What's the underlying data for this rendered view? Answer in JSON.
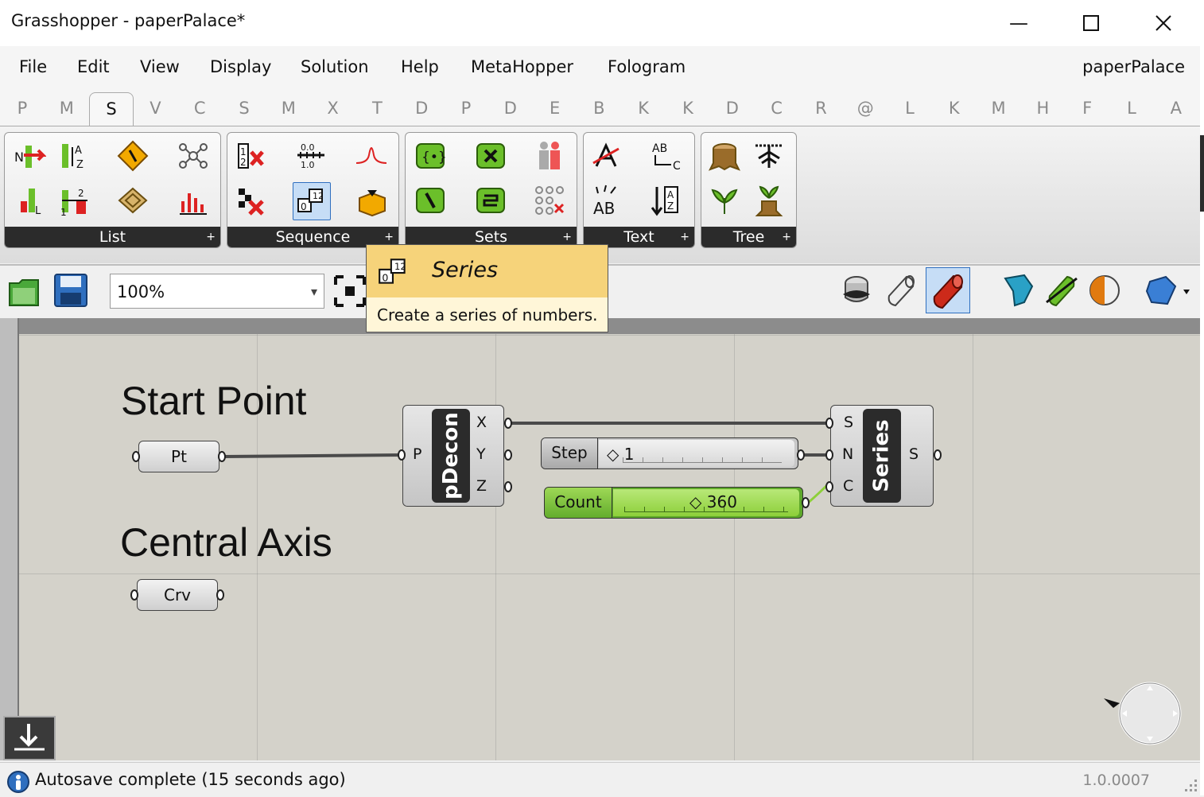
{
  "window": {
    "title": "Grasshopper - paperPalace*",
    "minimize": "—",
    "maximize": "☐",
    "close": "✕"
  },
  "menu": {
    "items": [
      "File",
      "Edit",
      "View",
      "Display",
      "Solution",
      "Help",
      "MetaHopper",
      "Fologram"
    ],
    "document": "paperPalace"
  },
  "tabs": [
    "P",
    "M",
    "S",
    "V",
    "C",
    "S",
    "M",
    "X",
    "T",
    "D",
    "P",
    "D",
    "E",
    "B",
    "K",
    "K",
    "D",
    "C",
    "R",
    "@",
    "L",
    "K",
    "M",
    "H",
    "F",
    "L",
    "A"
  ],
  "active_tab_index": 2,
  "ribbon": {
    "panels": [
      "List",
      "Sequence",
      "Sets",
      "Text",
      "Tree"
    ],
    "expand_glyph": "+"
  },
  "toolbar": {
    "zoom": "100%"
  },
  "tooltip": {
    "title": "Series",
    "description": "Create a series of numbers."
  },
  "canvas": {
    "groups": {
      "start_point": "Start Point",
      "central_axis": "Central Axis"
    },
    "params": {
      "pt": "Pt",
      "crv": "Crv"
    },
    "pdecon": {
      "name": "pDecon",
      "input": "P",
      "outputs": [
        "X",
        "Y",
        "Z"
      ]
    },
    "series": {
      "name": "Series",
      "inputs": [
        "S",
        "N",
        "C"
      ],
      "output": "S"
    },
    "sliders": {
      "step": {
        "label": "Step",
        "value": "1"
      },
      "count": {
        "label": "Count",
        "value": "360"
      }
    }
  },
  "status": {
    "message": "Autosave complete (15 seconds ago)",
    "version": "1.0.0007"
  },
  "colors": {
    "canvas": "#d4d2ca",
    "tooltip_head": "#f6d37a",
    "slider_green": "#8dcf3a",
    "accent_blue": "#2f6fbf"
  }
}
